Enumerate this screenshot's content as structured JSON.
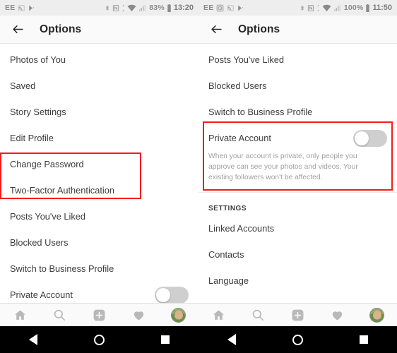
{
  "left": {
    "statusbar": {
      "carrier": "EE",
      "icons_left": [
        "cast-icon",
        "location-icon",
        "play-store-icon"
      ],
      "icons_right": [
        "bluetooth-icon",
        "nfc-icon",
        "vibrate-icon",
        "wifi-icon",
        "signal-icon"
      ],
      "battery": "83%",
      "battery_icon": "battery-icon",
      "time": "13:20"
    },
    "appbar": {
      "back_icon": "back-arrow-icon",
      "title": "Options"
    },
    "items": [
      {
        "label": "Photos of You"
      },
      {
        "label": "Saved"
      },
      {
        "label": "Story Settings"
      },
      {
        "label": "Edit Profile"
      },
      {
        "label": "Change Password"
      },
      {
        "label": "Two-Factor Authentication"
      },
      {
        "label": "Posts You've Liked"
      },
      {
        "label": "Blocked Users"
      },
      {
        "label": "Switch to Business Profile"
      },
      {
        "label": "Private Account"
      }
    ],
    "private_toggle_state": "off",
    "annotation": {
      "color": "#f61b1b",
      "covers": [
        "Change Password",
        "Two-Factor Authentication"
      ]
    }
  },
  "right": {
    "statusbar": {
      "carrier": "EE",
      "icons_left": [
        "alarm-icon",
        "cast-icon",
        "location-icon",
        "play-store-icon"
      ],
      "icons_right": [
        "bluetooth-icon",
        "nfc-icon",
        "vibrate-icon",
        "wifi-icon",
        "signal-icon"
      ],
      "battery": "100%",
      "battery_icon": "battery-icon",
      "time": "11:50"
    },
    "appbar": {
      "back_icon": "back-arrow-icon",
      "title": "Options"
    },
    "items_top": [
      {
        "label": "Posts You've Liked"
      },
      {
        "label": "Blocked Users"
      },
      {
        "label": "Switch to Business Profile"
      }
    ],
    "private_account": {
      "title": "Private Account",
      "description": "When your account is private, only people you approve can see your photos and videos. Your existing followers won't be affected.",
      "toggle_state": "off"
    },
    "settings_header": "SETTINGS",
    "items_bottom": [
      {
        "label": "Linked Accounts"
      },
      {
        "label": "Contacts"
      },
      {
        "label": "Language"
      }
    ],
    "annotation": {
      "color": "#f61b1b",
      "covers": [
        "Private Account"
      ]
    }
  },
  "tabbar": {
    "tabs": [
      {
        "name": "home-icon",
        "label": "Home"
      },
      {
        "name": "search-icon",
        "label": "Search"
      },
      {
        "name": "add-post-icon",
        "label": "Add"
      },
      {
        "name": "activity-heart-icon",
        "label": "Activity"
      },
      {
        "name": "profile-avatar",
        "label": "Profile"
      }
    ]
  },
  "navbar": {
    "buttons": [
      {
        "name": "android-back-button",
        "label": "Back"
      },
      {
        "name": "android-home-button",
        "label": "Home"
      },
      {
        "name": "android-recents-button",
        "label": "Recents"
      }
    ]
  }
}
